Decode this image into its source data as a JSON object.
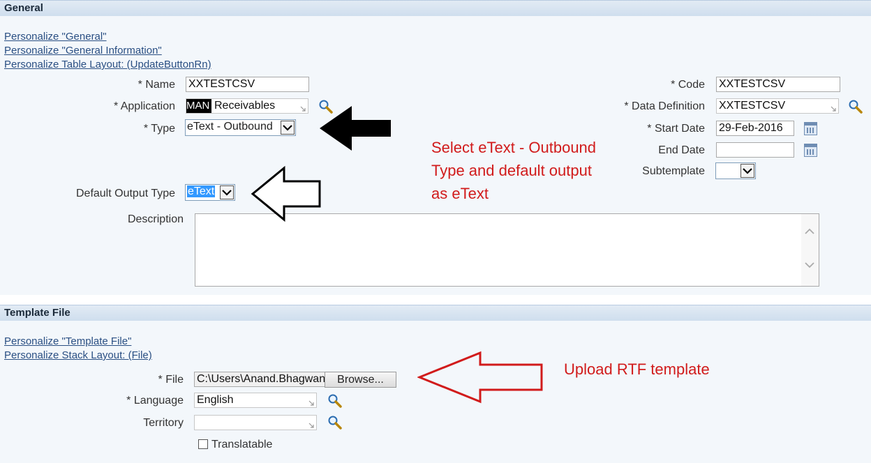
{
  "general": {
    "header": "General",
    "links": [
      "Personalize \"General\"",
      "Personalize \"General Information\"",
      "Personalize Table Layout: (UpdateButtonRn)"
    ],
    "name": {
      "label": "* Name",
      "value": "XXTESTCSV"
    },
    "application": {
      "label": "* Application",
      "prefix": "MAN",
      "value": "Receivables"
    },
    "type": {
      "label": "* Type",
      "value": "eText - Outbound"
    },
    "default_output_type": {
      "label": "Default Output Type",
      "value": "eText"
    },
    "description": {
      "label": "Description",
      "value": ""
    },
    "code": {
      "label": "* Code",
      "value": "XXTESTCSV"
    },
    "data_definition": {
      "label": "* Data Definition",
      "value": "XXTESTCSV"
    },
    "start_date": {
      "label": "* Start Date",
      "value": "29-Feb-2016"
    },
    "end_date": {
      "label": "End Date",
      "value": ""
    },
    "subtemplate": {
      "label": "Subtemplate",
      "value": ""
    },
    "annotation": [
      "Select eText - Outbound",
      "Type and default output",
      "as eText"
    ]
  },
  "template_file": {
    "header": "Template File",
    "links": [
      "Personalize \"Template File\"",
      "Personalize Stack Layout: (File)"
    ],
    "file": {
      "label": "* File",
      "value": "C:\\Users\\Anand.Bhagwan",
      "browse_label": "Browse..."
    },
    "language": {
      "label": "* Language",
      "value": "English"
    },
    "territory": {
      "label": "Territory",
      "value": ""
    },
    "translatable": {
      "label": "Translatable",
      "checked": false
    },
    "annotation": "Upload RTF template"
  },
  "colors": {
    "annotation": "#d11b1b",
    "link": "#2a4f83",
    "selection": "#3399ff"
  }
}
